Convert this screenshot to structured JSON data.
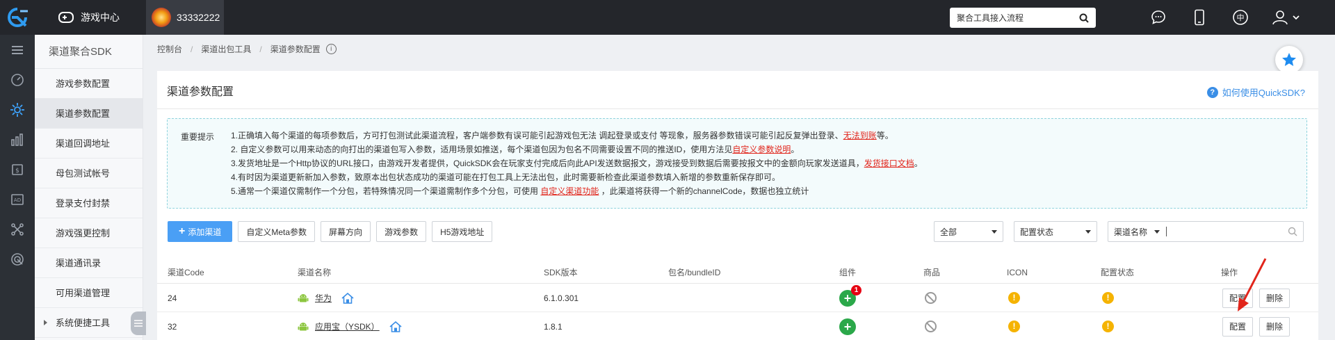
{
  "topbar": {
    "game_center": "游戏中心",
    "game_id": "33332222",
    "search_value": "聚合工具接入流程",
    "lang_icon_text": "中"
  },
  "subnav": {
    "title": "渠道聚合SDK",
    "items": [
      {
        "label": "游戏参数配置"
      },
      {
        "label": "渠道参数配置"
      },
      {
        "label": "渠道回调地址"
      },
      {
        "label": "母包测试帐号"
      },
      {
        "label": "登录支付封禁"
      },
      {
        "label": "游戏强更控制"
      },
      {
        "label": "渠道通讯录"
      },
      {
        "label": "可用渠道管理"
      },
      {
        "label": "系统便捷工具"
      }
    ]
  },
  "breadcrumb": {
    "items": [
      "控制台",
      "渠道出包工具",
      "渠道参数配置"
    ],
    "sep": "/",
    "info": "i"
  },
  "panel": {
    "title": "渠道参数配置",
    "help": "如何使用QuickSDK?",
    "help_icon": "?"
  },
  "notice": {
    "label": "重要提示",
    "line1_a": "1.正确填入每个渠道的每项参数后，方可打包测试此渠道流程，客户端参数有误可能引起游戏包无法 调起登录或支付 等现象，服务器参数错误可能引起反复弹出登录、",
    "line1_link": "无法到账",
    "line1_b": "等。",
    "line2_a": "2. 自定义参数可以用来动态的向打出的渠道包写入参数，适用场景如推送，每个渠道包因为包名不同需要设置不同的推送ID，使用方法见",
    "line2_link": "自定义参数说明",
    "line2_b": "。",
    "line3_a": "3.发货地址是一个Http协议的URL接口，由游戏开发者提供，QuickSDK会在玩家支付完成后向此API发送数据报文，游戏接受到数据后需要按报文中的金额向玩家发送道具，",
    "line3_link": "发货接口文档",
    "line3_b": "。",
    "line4": "4.有时因为渠道更新新加入参数，致原本出包状态成功的渠道可能在打包工具上无法出包，此时需要新检查此渠道参数填入新增的参数重新保存即可。",
    "line5_a": "5.通常一个渠道仅需制作一个分包，若特殊情况同一个渠道需制作多个分包，可使用 ",
    "line5_link": "自定义渠道功能",
    "line5_b": " ，此渠道将获得一个新的channelCode，数据也独立统计"
  },
  "toolbar": {
    "add_plus": "+",
    "add": "添加渠道",
    "meta": "自定义Meta参数",
    "orientation": "屏幕方向",
    "game_params": "游戏参数",
    "h5": "H5游戏地址"
  },
  "filters": {
    "all": "全部",
    "config_status": "配置状态",
    "channel_name": "渠道名称"
  },
  "table": {
    "headers": {
      "code": "渠道Code",
      "name": "渠道名称",
      "sdk": "SDK版本",
      "pkg": "包名/bundleID",
      "component": "组件",
      "goods": "商品",
      "icon": "ICON",
      "status": "配置状态",
      "ops": "操作"
    },
    "rows": [
      {
        "code": "24",
        "name": "华为",
        "sdk": "6.1.0.301",
        "pkg": "",
        "plus": "+",
        "badge": "1",
        "warn": "!",
        "config": "配置",
        "delete": "删除"
      },
      {
        "code": "32",
        "name": "应用宝（YSDK）",
        "sdk": "1.8.1",
        "pkg": "",
        "plus": "+",
        "badge": "",
        "warn": "!",
        "config": "配置",
        "delete": "删除"
      }
    ]
  },
  "colors": {
    "accent": "#4a9ff5",
    "topbar": "#24262b",
    "link_red": "#e1251b",
    "success": "#2ba84a",
    "warning": "#f5b301"
  }
}
